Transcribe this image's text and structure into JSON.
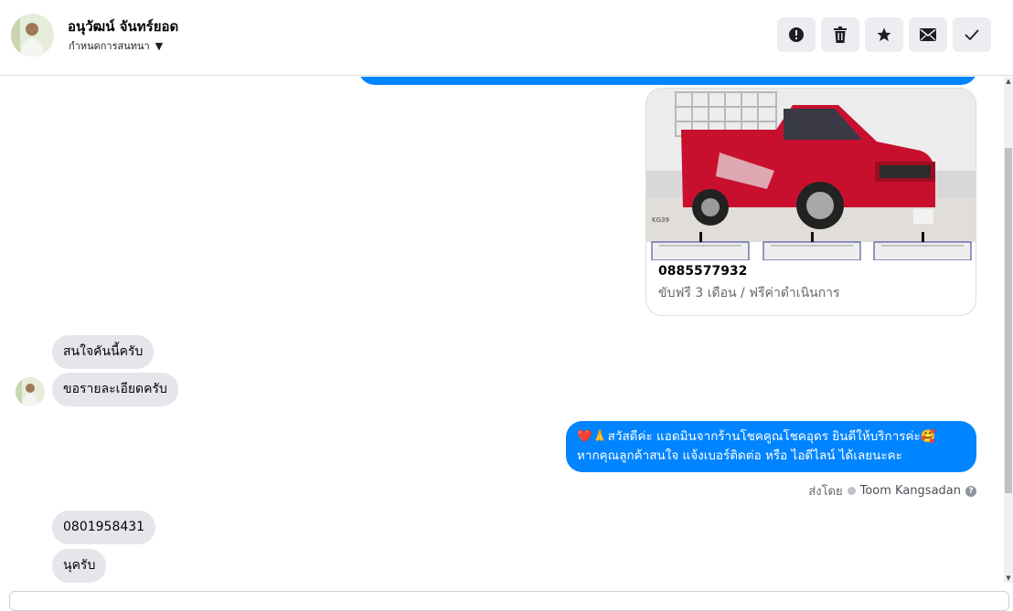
{
  "header": {
    "contact_name": "อนุวัฒน์ จันทร์ยอด",
    "subtitle": "กำหนดการสนทนา",
    "actions": [
      {
        "name": "report",
        "icon": "alert-icon"
      },
      {
        "name": "delete",
        "icon": "trash-icon"
      },
      {
        "name": "star",
        "icon": "star-icon"
      },
      {
        "name": "mark-unread",
        "icon": "mail-icon"
      },
      {
        "name": "done",
        "icon": "check-icon"
      }
    ]
  },
  "card": {
    "phone": "0885577932",
    "subtitle": "ขับฟรี 3 เดือน / ฟรีค่าดำเนินการ"
  },
  "messages": {
    "incoming_1": "สนใจคันนี้ครับ",
    "incoming_2": "ขอรายละเอียดครับ",
    "outgoing_1_line1": "❤️🙏สวัสดีค่ะ แอดมินจากร้านโชคคูณโชคอุดร ยินดีให้บริการค่ะ🥰",
    "outgoing_1_line2": "หากคุณลูกค้าสนใจ แจ้งเบอร์ติดต่อ หรือ ไอดีไลน์ ได้เลยนะคะ",
    "sent_by_label": "ส่งโดย",
    "sent_by_name": "Toom Kangsadan",
    "incoming_3": "0801958431",
    "incoming_4": "นุครับ"
  },
  "colors": {
    "outgoing_bubble": "#0084ff",
    "incoming_bubble": "#e4e6eb",
    "truck": "#c8102e"
  }
}
